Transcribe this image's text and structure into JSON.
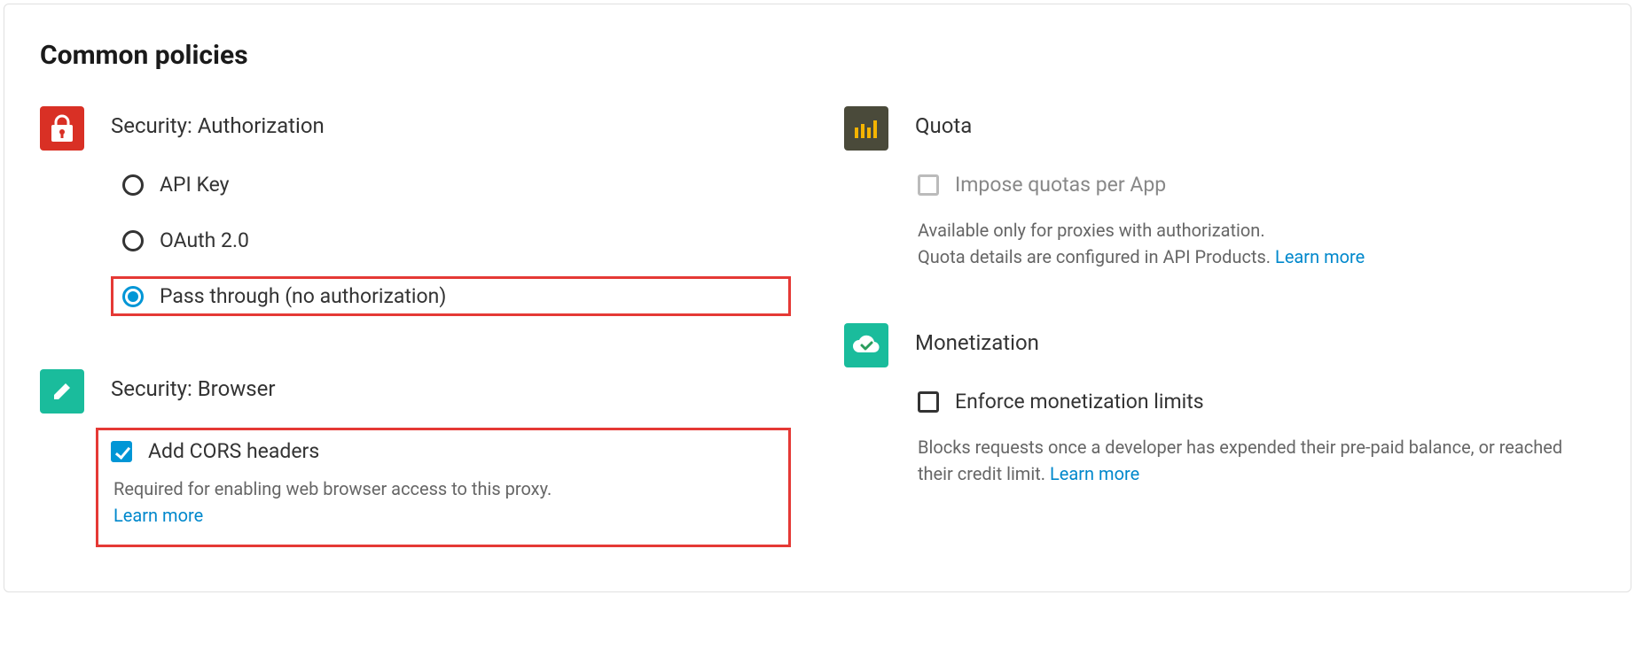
{
  "section_title": "Common policies",
  "security_auth": {
    "icon": "lock-icon",
    "title": "Security: Authorization",
    "options": [
      {
        "label": "API Key",
        "selected": false
      },
      {
        "label": "OAuth 2.0",
        "selected": false
      },
      {
        "label": "Pass through (no authorization)",
        "selected": true,
        "highlight": true
      }
    ]
  },
  "security_browser": {
    "icon": "pencil-icon",
    "title": "Security: Browser",
    "option": {
      "label": "Add CORS headers",
      "checked": true
    },
    "desc": "Required for enabling web browser access to this proxy.",
    "learn_more": "Learn more",
    "highlight": true
  },
  "quota": {
    "icon": "bars-icon",
    "title": "Quota",
    "option": {
      "label": "Impose quotas per App",
      "checked": false,
      "disabled": true
    },
    "desc_line1": "Available only for proxies with authorization.",
    "desc_line2": "Quota details are configured in API Products.",
    "learn_more": "Learn more"
  },
  "monetization": {
    "icon": "cloud-check-icon",
    "title": "Monetization",
    "option": {
      "label": "Enforce monetization limits",
      "checked": false
    },
    "desc": "Blocks requests once a developer has expended their pre-paid balance, or reached their credit limit.",
    "learn_more": "Learn more"
  }
}
